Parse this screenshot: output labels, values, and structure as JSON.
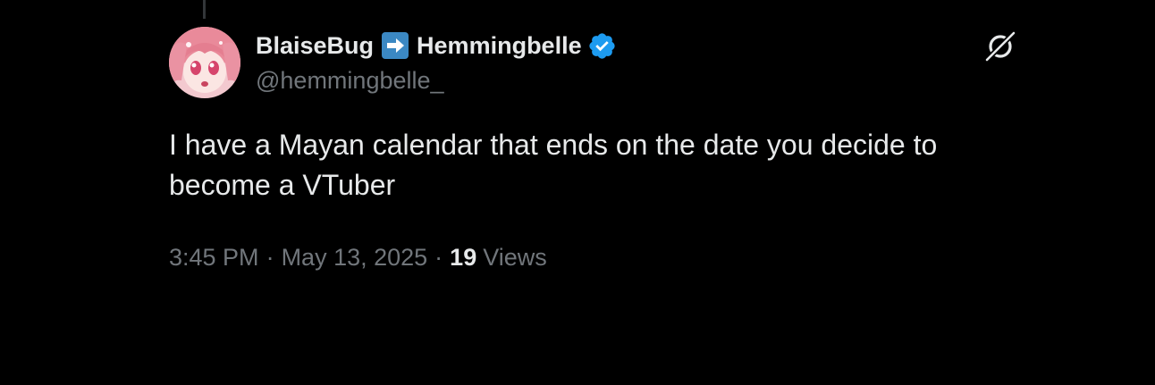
{
  "author": {
    "name_before_emoji": "BlaiseBug",
    "name_emoji": "arrow-right-emoji",
    "name_after_emoji": "Hemmingbelle",
    "handle": "@hemmingbelle_",
    "verified": true,
    "verified_color": "#1d9bf0"
  },
  "header_icon": "grok-icon",
  "tweet": {
    "text": "I have a Mayan calendar that ends on the date you decide to become a VTuber"
  },
  "meta": {
    "time": "3:45 PM",
    "separator": "·",
    "date": "May 13, 2025",
    "views_count": "19",
    "views_label": "Views"
  },
  "colors": {
    "background": "#000000",
    "primary_text": "#e7e9ea",
    "secondary_text": "#71767b",
    "emoji_blue": "#3b88c3"
  }
}
